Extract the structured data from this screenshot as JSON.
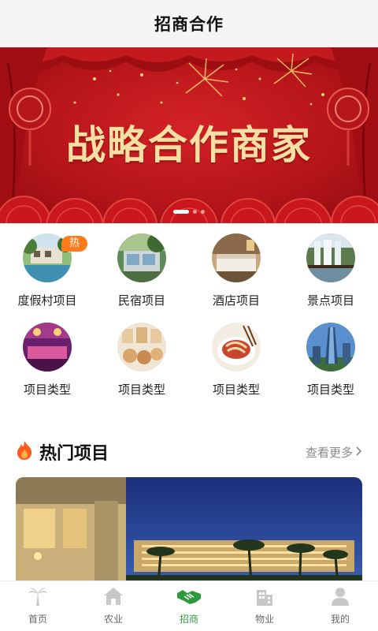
{
  "header": {
    "title": "招商合作"
  },
  "banner": {
    "headline": "战略合作商家",
    "slide_count": 3,
    "active_slide": 1
  },
  "categories": [
    {
      "label": "度假村项目",
      "badge": "热",
      "icon": "resort-photo"
    },
    {
      "label": "民宿项目",
      "icon": "homestay-photo"
    },
    {
      "label": "酒店项目",
      "icon": "hotel-room-photo"
    },
    {
      "label": "景点项目",
      "icon": "waterfall-photo"
    },
    {
      "label": "项目类型",
      "icon": "ktv-room-photo"
    },
    {
      "label": "项目类型",
      "icon": "food-gift-photo"
    },
    {
      "label": "项目类型",
      "icon": "noodle-bowl-photo"
    },
    {
      "label": "项目类型",
      "icon": "skyscraper-photo"
    }
  ],
  "hot_section": {
    "title": "热门项目",
    "more": "查看更多",
    "icon": "flame-icon"
  },
  "tabbar": {
    "items": [
      {
        "label": "首页",
        "icon": "palm-tree-icon",
        "active": false
      },
      {
        "label": "农业",
        "icon": "house-icon",
        "active": false
      },
      {
        "label": "招商",
        "icon": "handshake-icon",
        "active": true
      },
      {
        "label": "物业",
        "icon": "building-icon",
        "active": false
      },
      {
        "label": "我的",
        "icon": "person-icon",
        "active": false
      }
    ]
  },
  "colors": {
    "accent": "#2e9a3e",
    "banner_red": "#c8191e",
    "gold_text": "#f7dfa4",
    "badge": "#ff7a1a",
    "flame": "#ff5a1f"
  }
}
